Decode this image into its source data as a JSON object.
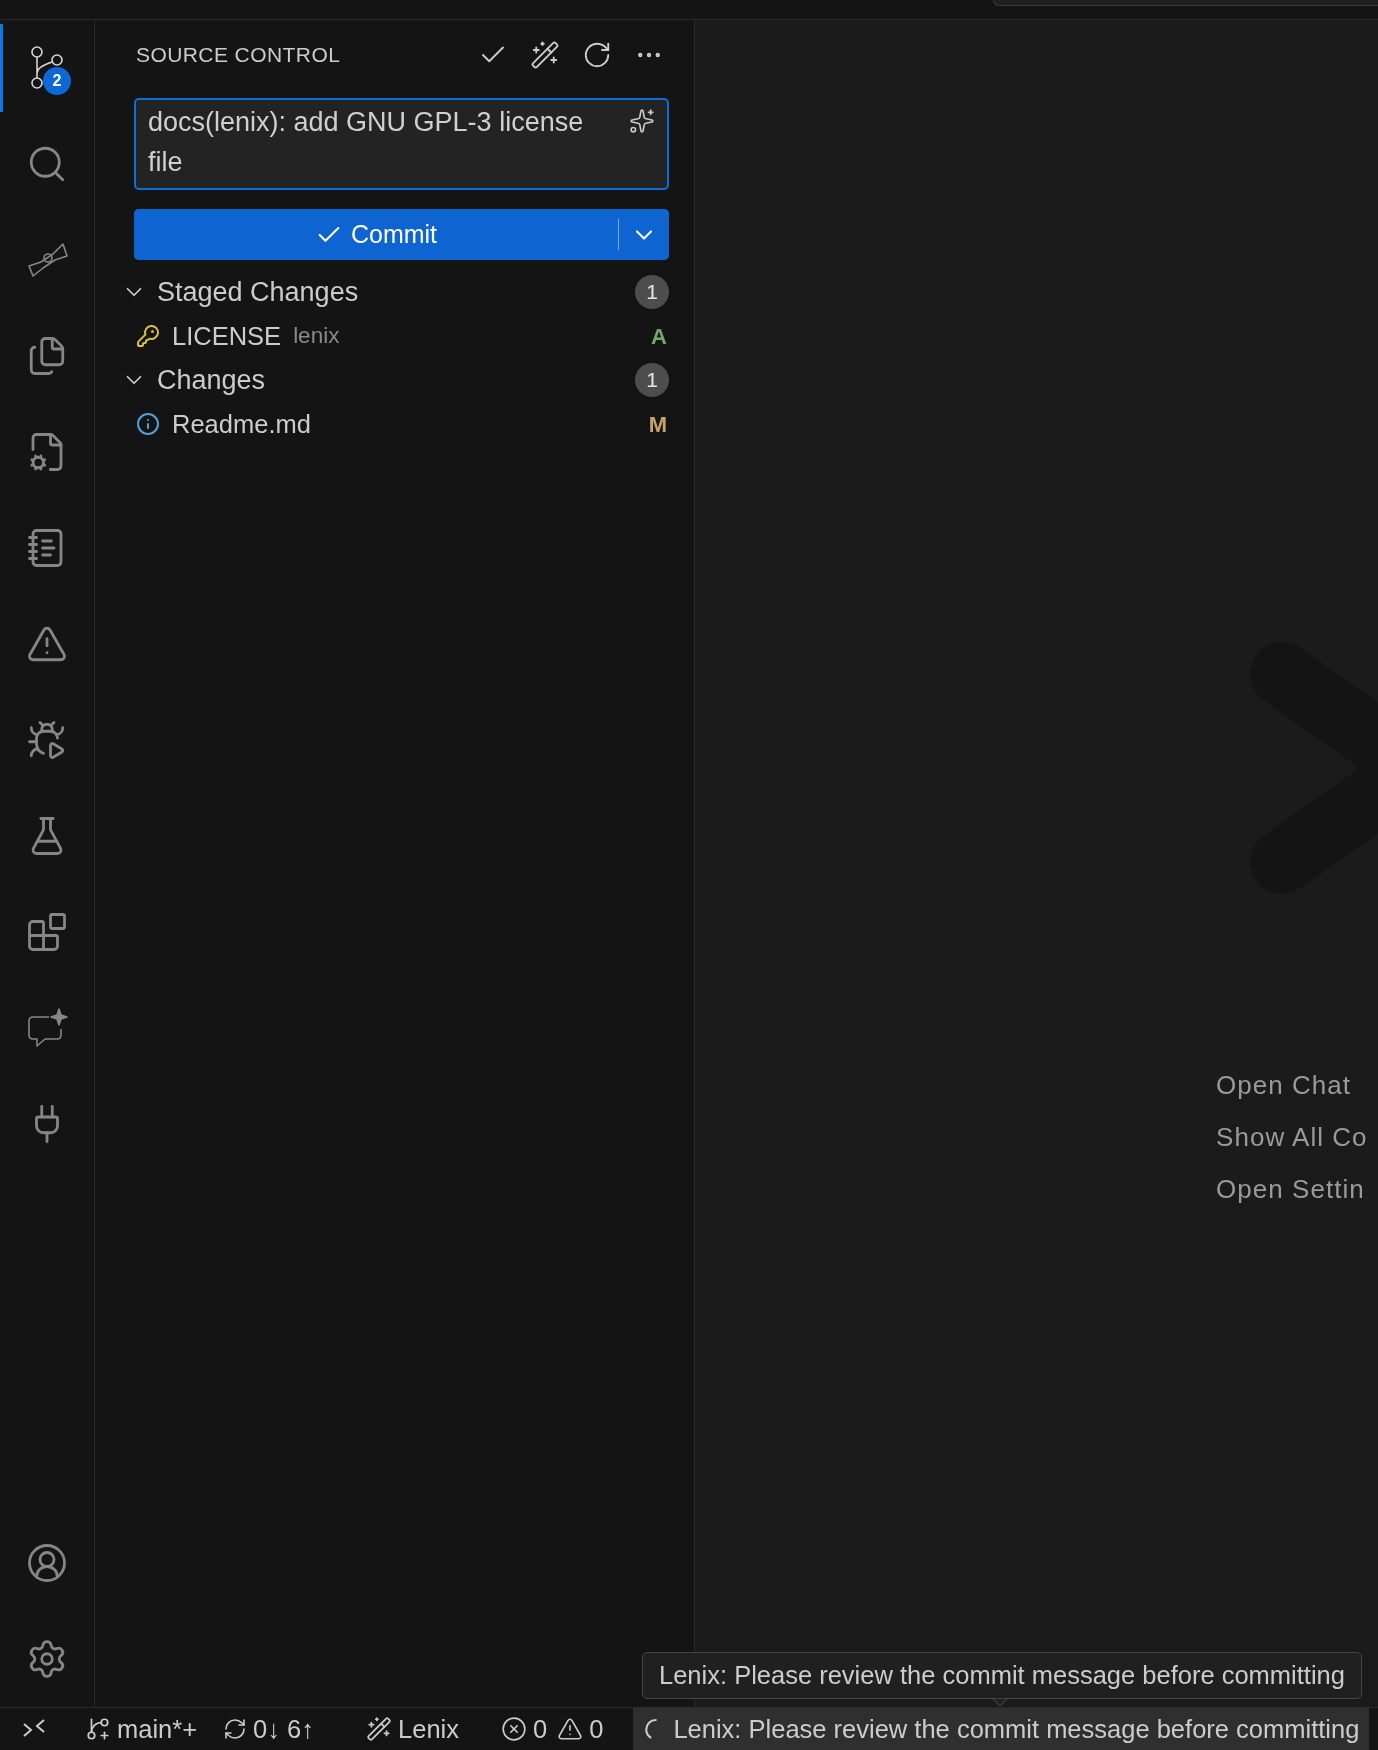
{
  "activity_bar": {
    "items": [
      {
        "kind": "source-control",
        "selected": true,
        "badge": "2"
      },
      {
        "kind": "search",
        "selected": false
      },
      {
        "kind": "bowtie",
        "selected": false
      },
      {
        "kind": "files",
        "selected": false
      },
      {
        "kind": "file-settings",
        "selected": false
      },
      {
        "kind": "notes",
        "selected": false
      },
      {
        "kind": "warning",
        "selected": false
      },
      {
        "kind": "run-debug",
        "selected": false
      },
      {
        "kind": "flask",
        "selected": false
      },
      {
        "kind": "extensions",
        "selected": false
      },
      {
        "kind": "chat",
        "selected": false
      },
      {
        "kind": "plug",
        "selected": false
      }
    ],
    "bottom_items": [
      {
        "kind": "account"
      },
      {
        "kind": "settings"
      }
    ]
  },
  "side_panel": {
    "title": "SOURCE CONTROL",
    "actions": [
      {
        "kind": "check"
      },
      {
        "kind": "wand"
      },
      {
        "kind": "refresh"
      },
      {
        "kind": "more"
      }
    ],
    "commit_message": {
      "value": "docs(lenix): add GNU GPL-3 license file"
    },
    "commit_button": {
      "label": "Commit"
    },
    "groups": [
      {
        "title": "Staged Changes",
        "count": "1",
        "expanded": true,
        "files": [
          {
            "kind": "license",
            "name": "LICENSE",
            "folder": "lenix",
            "status": "A",
            "color": "#73a76b"
          }
        ]
      },
      {
        "title": "Changes",
        "count": "1",
        "expanded": true,
        "files": [
          {
            "kind": "info",
            "name": "Readme.md",
            "status": "M",
            "color": "#c9a26d"
          }
        ]
      }
    ]
  },
  "editor": {
    "commands": [
      "Open Chat",
      "Show All Co",
      "Open Settin"
    ]
  },
  "tooltip": {
    "text": "Lenix: Please review the commit message before committing"
  },
  "status_bar": {
    "items": [
      {
        "kind": "remote",
        "highlighted": false
      },
      {
        "kind": "branch",
        "text": "main*+",
        "highlighted": false
      },
      {
        "kind": "sync",
        "text": "0↓ 6↑",
        "highlighted": false
      },
      {
        "kind": "wand",
        "text": "Lenix",
        "highlighted": false
      },
      {
        "kind": "problems",
        "errors": "0",
        "warnings": "0",
        "highlighted": false
      },
      {
        "kind": "progress",
        "text": "Lenix: Please review the commit message before committing",
        "highlighted": true
      }
    ]
  }
}
